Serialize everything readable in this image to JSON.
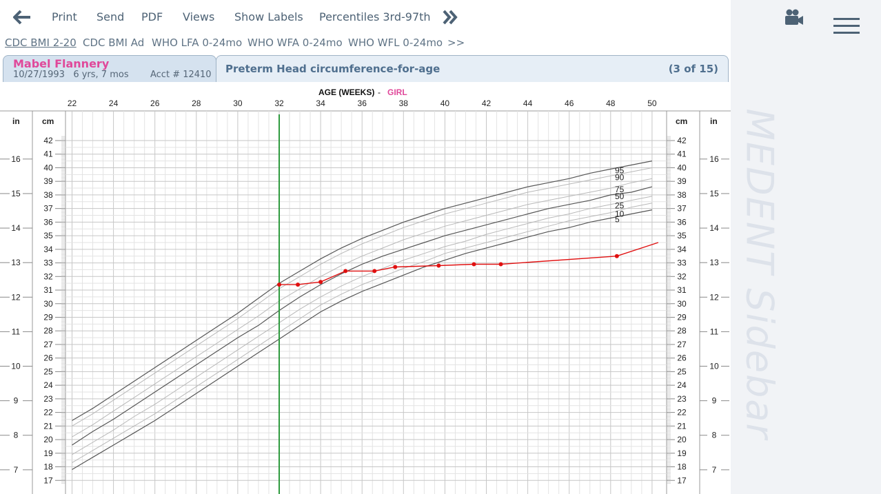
{
  "toolbar": {
    "back_icon": "arrow-left-icon",
    "print": "Print",
    "send": "Send",
    "pdf": "PDF",
    "views": "Views",
    "show_labels": "Show Labels",
    "percentiles": "Percentiles 3rd-97th",
    "more_icon": "double-chevron-right-icon"
  },
  "chart_tabs": [
    {
      "label": "CDC BMI 2-20",
      "active": true
    },
    {
      "label": "CDC BMI Ad",
      "active": false
    },
    {
      "label": "WHO LFA 0-24mo",
      "active": false
    },
    {
      "label": "WHO WFA 0-24mo",
      "active": false
    },
    {
      "label": "WHO WFL 0-24mo",
      "active": false
    },
    {
      "label": ">>",
      "active": false
    }
  ],
  "patient": {
    "name": "Mabel Flannery",
    "dob_age": "10/27/1993   6 yrs, 7 mos",
    "account": "Acct # 12410"
  },
  "chart_header": {
    "title": "Preterm Head circumference-for-age",
    "count": "(3 of 15)"
  },
  "sidebar": {
    "label": "MEDENT Sidebar",
    "video_icon": "video-camera-icon",
    "menu_icon": "hamburger-menu-icon"
  },
  "colors": {
    "accent_pink": "#e0489a",
    "patient_line": "#e01010",
    "current_age_line": "#2e9a3e",
    "toolbar_text": "#4d6275"
  },
  "chart_data": {
    "type": "line",
    "title": "AGE (WEEKS)",
    "sex_label": "GIRL",
    "xlabel": "AGE (WEEKS)",
    "ylabel_left": "cm",
    "ylabel_right": "cm",
    "ylabel_in": "in",
    "x_ticks": [
      22,
      24,
      26,
      28,
      30,
      32,
      34,
      36,
      38,
      40,
      42,
      44,
      46,
      48,
      50
    ],
    "y_ticks_cm": [
      17,
      18,
      19,
      20,
      21,
      22,
      23,
      24,
      25,
      26,
      27,
      28,
      29,
      30,
      31,
      32,
      33,
      34,
      35,
      36,
      37,
      38,
      39,
      40,
      41,
      42
    ],
    "y_ticks_in": [
      7,
      8,
      9,
      10,
      11,
      12,
      13,
      14,
      15,
      16
    ],
    "xlim": [
      22,
      50
    ],
    "ylim_cm": [
      16.6,
      42.5
    ],
    "grid": true,
    "current_age_marker_weeks": 32,
    "percentile_x": [
      22,
      23,
      24,
      25,
      26,
      27,
      28,
      29,
      30,
      31,
      32,
      33,
      34,
      35,
      36,
      37,
      38,
      39,
      40,
      41,
      42,
      43,
      44,
      45,
      46,
      47,
      48,
      49,
      50
    ],
    "percentiles": [
      {
        "name": "95",
        "dark": true,
        "values": [
          21.4,
          22.3,
          23.3,
          24.3,
          25.3,
          26.3,
          27.3,
          28.3,
          29.3,
          30.4,
          31.5,
          32.4,
          33.3,
          34.1,
          34.8,
          35.4,
          36.0,
          36.5,
          37.0,
          37.4,
          37.8,
          38.2,
          38.6,
          38.9,
          39.2,
          39.6,
          39.9,
          40.2,
          40.5
        ]
      },
      {
        "name": "90",
        "dark": false,
        "values": [
          21.0,
          21.9,
          22.9,
          23.9,
          24.9,
          25.9,
          26.9,
          27.9,
          28.9,
          30.0,
          31.1,
          32.0,
          32.9,
          33.7,
          34.4,
          35.0,
          35.6,
          36.1,
          36.6,
          37.0,
          37.4,
          37.8,
          38.2,
          38.5,
          38.8,
          39.1,
          39.4,
          39.7,
          40.0
        ]
      },
      {
        "name": "75",
        "dark": false,
        "values": [
          20.2,
          21.1,
          22.1,
          23.1,
          24.1,
          25.1,
          26.1,
          27.1,
          28.1,
          29.1,
          30.2,
          31.1,
          32.0,
          32.8,
          33.5,
          34.1,
          34.7,
          35.2,
          35.7,
          36.1,
          36.5,
          36.9,
          37.3,
          37.6,
          37.9,
          38.2,
          38.5,
          38.9,
          39.2
        ]
      },
      {
        "name": "50",
        "dark": true,
        "values": [
          19.6,
          20.6,
          21.5,
          22.5,
          23.5,
          24.5,
          25.5,
          26.5,
          27.5,
          28.4,
          29.5,
          30.5,
          31.4,
          32.2,
          32.9,
          33.5,
          34.0,
          34.5,
          35.0,
          35.4,
          35.8,
          36.2,
          36.6,
          37.0,
          37.3,
          37.6,
          38.0,
          38.2,
          38.6
        ]
      },
      {
        "name": "25",
        "dark": false,
        "values": [
          18.9,
          19.8,
          20.7,
          21.7,
          22.6,
          23.6,
          24.6,
          25.6,
          26.6,
          27.6,
          28.6,
          29.6,
          30.5,
          31.3,
          32.0,
          32.6,
          33.2,
          33.7,
          34.2,
          34.6,
          35.1,
          35.5,
          35.9,
          36.3,
          36.6,
          37.0,
          37.3,
          37.6,
          37.9
        ]
      },
      {
        "name": "10",
        "dark": false,
        "values": [
          18.3,
          19.2,
          20.1,
          21.0,
          21.9,
          22.9,
          23.9,
          24.9,
          25.9,
          26.9,
          27.9,
          28.9,
          29.9,
          30.7,
          31.4,
          32.0,
          32.6,
          33.1,
          33.7,
          34.1,
          34.5,
          34.9,
          35.3,
          35.7,
          36.1,
          36.4,
          36.7,
          37.1,
          37.4
        ]
      },
      {
        "name": "5",
        "dark": true,
        "values": [
          17.8,
          18.7,
          19.6,
          20.5,
          21.4,
          22.4,
          23.4,
          24.4,
          25.4,
          26.4,
          27.4,
          28.4,
          29.4,
          30.2,
          30.9,
          31.5,
          32.1,
          32.7,
          33.2,
          33.7,
          34.1,
          34.5,
          34.9,
          35.3,
          35.6,
          36.0,
          36.3,
          36.6,
          36.9
        ]
      }
    ],
    "patient_series": {
      "x": [
        32.0,
        32.9,
        34.0,
        35.2,
        36.6,
        37.6,
        39.7,
        41.4,
        42.7,
        48.3
      ],
      "y": [
        31.4,
        31.4,
        31.6,
        32.4,
        32.4,
        32.7,
        32.8,
        32.9,
        32.9,
        33.5
      ],
      "trend_end": {
        "x": 50.3,
        "y": 34.5
      }
    }
  }
}
